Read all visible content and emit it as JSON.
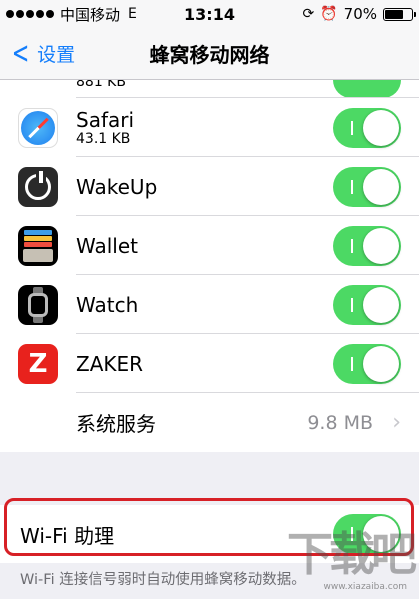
{
  "status_bar": {
    "carrier": "中国移动",
    "network": "E",
    "time": "13:14",
    "battery": "70%",
    "battery_level": 0.7
  },
  "nav": {
    "back_label": "设置",
    "title": "蜂窝移动网络"
  },
  "partial_row": {
    "sub": "881 KB"
  },
  "apps": [
    {
      "name": "Safari",
      "usage": "43.1 KB",
      "enabled": true,
      "icon": "safari-icon"
    },
    {
      "name": "WakeUp",
      "usage": "",
      "enabled": true,
      "icon": "wakeup-icon"
    },
    {
      "name": "Wallet",
      "usage": "",
      "enabled": true,
      "icon": "wallet-icon"
    },
    {
      "name": "Watch",
      "usage": "",
      "enabled": true,
      "icon": "watch-icon"
    },
    {
      "name": "ZAKER",
      "usage": "",
      "enabled": true,
      "icon": "zaker-icon"
    }
  ],
  "zaker_glyph": "Z",
  "system_services": {
    "label": "系统服务",
    "value": "9.8 MB"
  },
  "wifi_assist": {
    "label": "Wi-Fi 助理",
    "enabled": true,
    "footer": "Wi-Fi 连接信号弱时自动使用蜂窝移动数据。"
  },
  "watermark": {
    "text": "下载吧",
    "sub": "www.xiazaiba.com"
  },
  "colors": {
    "accent": "#147efb",
    "toggle_on": "#4cd964",
    "highlight": "#d72026"
  }
}
